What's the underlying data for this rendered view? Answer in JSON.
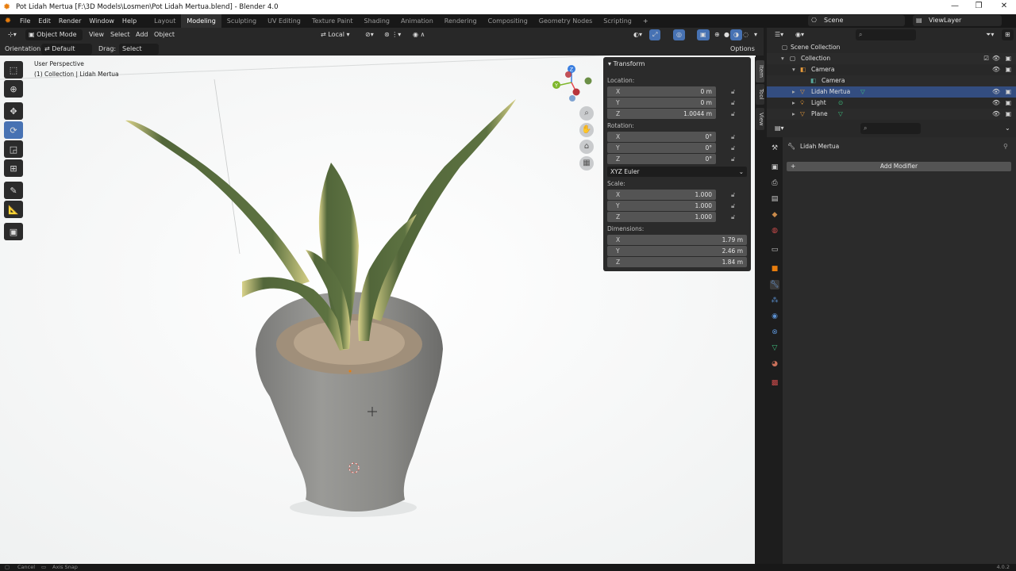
{
  "window": {
    "title": "Pot Lidah Mertua [F:\\3D Models\\Losmen\\Pot Lidah Mertua.blend] - Blender 4.0"
  },
  "menu": [
    "File",
    "Edit",
    "Render",
    "Window",
    "Help"
  ],
  "workspaces": [
    "Layout",
    "Modeling",
    "Sculpting",
    "UV Editing",
    "Texture Paint",
    "Shading",
    "Animation",
    "Rendering",
    "Compositing",
    "Geometry Nodes",
    "Scripting"
  ],
  "active_workspace": "Modeling",
  "scene_name": "Scene",
  "view_layer": "ViewLayer",
  "viewport_header": {
    "mode": "Object Mode",
    "view": "View",
    "select": "Select",
    "add": "Add",
    "object": "Object",
    "transform_orientation": "Local"
  },
  "tool_options": {
    "orientation_label": "Orientation:",
    "orientation_value": "Default",
    "drag_label": "Drag:",
    "drag_value": "Select Box",
    "options": "Options"
  },
  "viewport": {
    "perspective": "User Perspective",
    "collection_info": "(1) Collection | Lidah Mertua",
    "gizmo_axes": [
      "X",
      "Y",
      "Z"
    ]
  },
  "side_tabs": [
    "Item",
    "Tool",
    "View"
  ],
  "transform": {
    "title": "Transform",
    "location_label": "Location:",
    "location": [
      {
        "axis": "X",
        "value": "0 m"
      },
      {
        "axis": "Y",
        "value": "0 m"
      },
      {
        "axis": "Z",
        "value": "1.0044 m"
      }
    ],
    "rotation_label": "Rotation:",
    "rotation": [
      {
        "axis": "X",
        "value": "0°"
      },
      {
        "axis": "Y",
        "value": "0°"
      },
      {
        "axis": "Z",
        "value": "0°"
      }
    ],
    "rotation_mode": "XYZ Euler",
    "scale_label": "Scale:",
    "scale": [
      {
        "axis": "X",
        "value": "1.000"
      },
      {
        "axis": "Y",
        "value": "1.000"
      },
      {
        "axis": "Z",
        "value": "1.000"
      }
    ],
    "dimensions_label": "Dimensions:",
    "dimensions": [
      {
        "axis": "X",
        "value": "1.79 m"
      },
      {
        "axis": "Y",
        "value": "2.46 m"
      },
      {
        "axis": "Z",
        "value": "1.84 m"
      }
    ]
  },
  "outliner": {
    "rows": [
      {
        "label": "Scene Collection"
      },
      {
        "label": "Collection"
      },
      {
        "label": "Camera"
      },
      {
        "label": "Camera"
      },
      {
        "label": "Lidah Mertua"
      },
      {
        "label": "Light"
      },
      {
        "label": "Plane"
      }
    ]
  },
  "properties": {
    "object_name": "Lidah Mertua",
    "add_modifier": "Add Modifier"
  },
  "status": {
    "cancel": "Cancel",
    "axis_snap": "Axis Snap",
    "version": "4.0.2"
  },
  "colors": {
    "accent": "#4772b3",
    "blender_orange": "#e87d0d",
    "mesh_green": "#3fbf7f",
    "axis_x": "#e8474f",
    "axis_y": "#7fb72c",
    "axis_z": "#3a7fe0"
  }
}
